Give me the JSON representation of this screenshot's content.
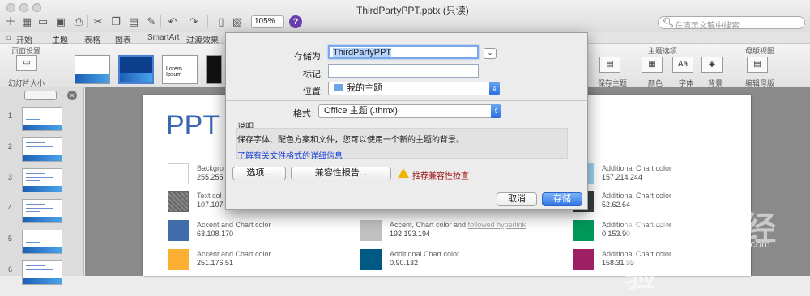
{
  "window": {
    "title": "ThirdPartyPPT.pptx (只读)",
    "zoom": "105%"
  },
  "search": {
    "placeholder": "在演示文稿中搜索"
  },
  "ribbon_tabs": [
    "开始",
    "主题",
    "表格",
    "图表",
    "SmartArt",
    "过渡效果"
  ],
  "ribbon": {
    "page_setup": "页面设置",
    "slide_size": "幻灯片大小",
    "theme_thumb_text": "Lorem Ipsum",
    "theme_options": "主题选项",
    "master_view": "母版视图",
    "save_theme": "保存主题",
    "colors": "颜色",
    "fonts": "字体",
    "background": "背景",
    "edit_master": "编辑母版"
  },
  "slides": [
    "1",
    "2",
    "3",
    "4",
    "5",
    "6"
  ],
  "slide": {
    "title": "PPT",
    "swatches": [
      {
        "name": "Backgro",
        "value": "255.255"
      },
      {
        "name": "Text col",
        "value": "107.107"
      },
      {
        "name": "Accent and Chart color",
        "value": "63.108.170",
        "color": "#3f6caa"
      },
      {
        "name": "Accent and Chart color",
        "value": "251.176.51",
        "color": "#fbb033"
      },
      {
        "name": "Accent, Chart color and ",
        "link": "followed hyperlink",
        "value": "192.193.194",
        "color": "#c0c1c2"
      },
      {
        "name": "Additional Chart color",
        "value": "0.90.132",
        "color": "#005a84"
      },
      {
        "name": "Additional Chart color",
        "value": "157.214.244",
        "color": "#9dd6f4"
      },
      {
        "name": "Additional Chart color",
        "value": "52.62.64",
        "color": "#343e40"
      },
      {
        "name": "Additional Chart color",
        "value": "0.153.90",
        "color": "#00995a"
      },
      {
        "name": "Additional Chart color",
        "value": "158.31.99",
        "color": "#9e1f63"
      }
    ]
  },
  "dialog": {
    "save_as_label": "存储为:",
    "save_as_value": "ThirdPartyPPT",
    "tags_label": "标记:",
    "tags_value": "",
    "where_label": "位置:",
    "where_value": "我的主题",
    "format_label": "格式:",
    "format_value": "Office 主题 (.thmx)",
    "description_heading": "说明",
    "description": "保存字体、配色方案和文件，您可以使用一个新的主题的背景。",
    "learn_more_link": "了解有关文件格式的详细信息",
    "options_button": "选项...",
    "compat_button": "兼容性报告...",
    "compat_warning": "推荐兼容性检查",
    "cancel_button": "取消",
    "save_button": "存储"
  },
  "watermark": {
    "brand": "Baidu 经验",
    "url": "jingyan.baidu.com"
  }
}
